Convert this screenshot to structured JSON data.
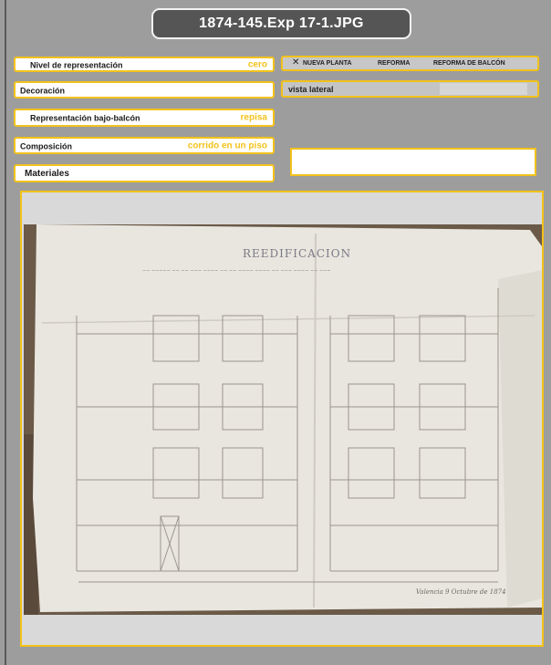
{
  "title": "1874-145.Exp 17-1.JPG",
  "fields": {
    "nivel": {
      "label": "Nivel de representación",
      "value": "cero"
    },
    "decoracion": {
      "label": "Decoración",
      "value": ""
    },
    "bajo_balcon": {
      "label": "Representación bajo-balcón",
      "value": "repisa"
    },
    "composicion": {
      "label": "Composición",
      "value": "corrido en un piso"
    },
    "materiales": {
      "label": "Materiales",
      "value": ""
    }
  },
  "options": {
    "check_mark": "✕",
    "items": [
      "NUEVA PLANTA",
      "REFORMA",
      "REFORMA DE BALCÓN"
    ]
  },
  "vista": {
    "label": "vista lateral"
  },
  "photo": {
    "heading": "REEDIFICACION",
    "signature": "Valencia 9 Octubre de 1874",
    "icon": "architectural-elevation-drawing"
  },
  "colors": {
    "accent": "#f3c21b",
    "title_bg": "#555555",
    "page_bg": "#9d9d9d"
  }
}
